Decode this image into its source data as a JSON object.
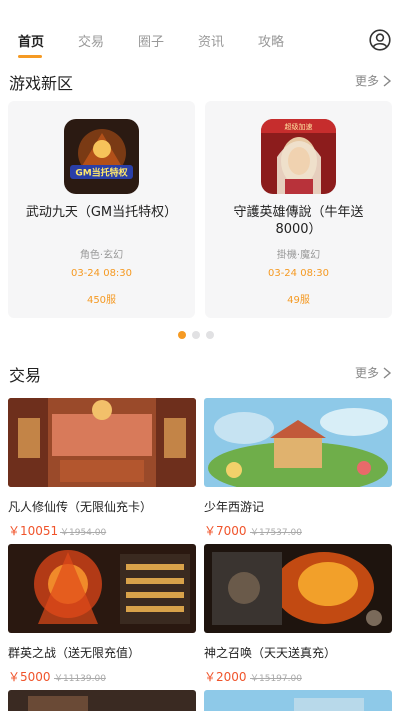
{
  "nav": {
    "tabs": [
      {
        "label": "首页",
        "active": true
      },
      {
        "label": "交易",
        "active": false
      },
      {
        "label": "圈子",
        "active": false
      },
      {
        "label": "资讯",
        "active": false
      },
      {
        "label": "攻略",
        "active": false
      }
    ],
    "user_icon": "user-circle-icon"
  },
  "new_games": {
    "title": "游戏新区",
    "more_label": "更多",
    "cards": [
      {
        "name": "武动九天（GM当托特权）",
        "tags": "角色·玄幻",
        "time": "03-24 08:30",
        "server": "450服",
        "icon_text": "GM当托特权"
      },
      {
        "name": "守護英雄傳說（牛年送8000）",
        "tags": "掛機·魔幻",
        "time": "03-24 08:30",
        "server": "49服",
        "icon_text": "超级加速"
      }
    ],
    "pager": {
      "count": 3,
      "active_index": 0
    }
  },
  "trade": {
    "title": "交易",
    "more_label": "更多",
    "items": [
      {
        "title": "凡人修仙传（无限仙充卡）",
        "price": "￥10051",
        "old_price": "￥1954.00"
      },
      {
        "title": "少年西游记",
        "price": "￥7000",
        "old_price": "￥17537.00"
      },
      {
        "title": "群英之战（送无限充值）",
        "price": "￥5000",
        "old_price": "￥11139.00"
      },
      {
        "title": "神之召唤（天天送真充）",
        "price": "￥2000",
        "old_price": "￥15197.00"
      }
    ]
  },
  "colors": {
    "accent": "#f59a23",
    "price": "#f0542b",
    "card_bg": "#f6f6f7"
  }
}
